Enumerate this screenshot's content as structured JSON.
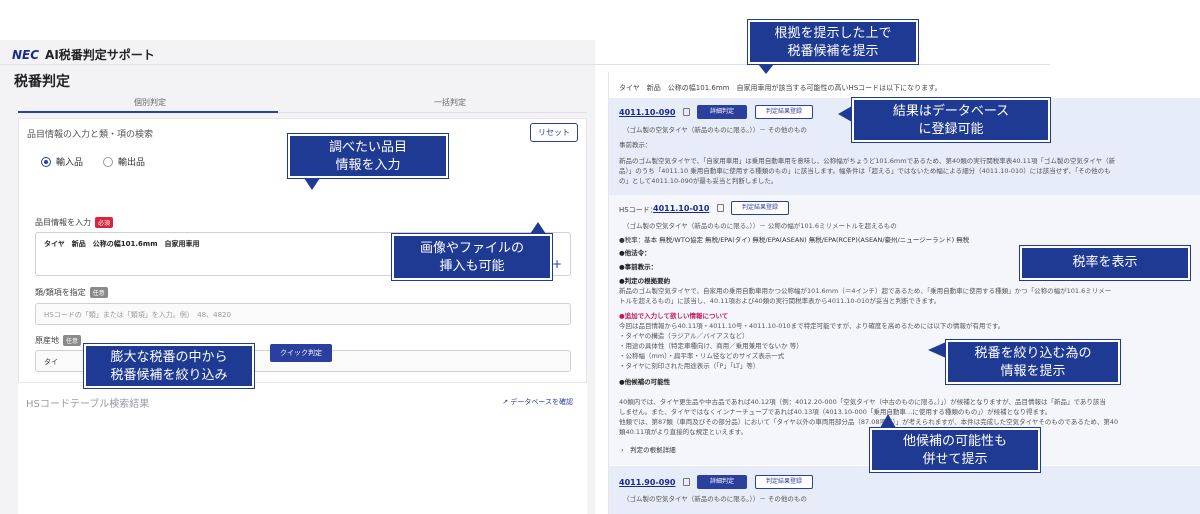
{
  "app": {
    "brand": "NEC",
    "title": "AI税番判定サポート"
  },
  "page_title": "税番判定",
  "tabs": [
    {
      "label": "個別判定"
    },
    {
      "label": "一括判定"
    }
  ],
  "form": {
    "section_title": "品目情報の入力と類・項の検索",
    "reset_label": "リセット",
    "radio_import": "輸入品",
    "radio_export": "輸出品",
    "item_label": "品目情報を入力",
    "required_badge": "必須",
    "item_value": "タイヤ　新品　公称の幅101.6mm　自家用車用",
    "class_label": "類/類項を指定",
    "optional_badge": "任意",
    "class_placeholder": "HSコードの「類」または「類項」を入力。例）　48、4820",
    "origin_label": "原産地",
    "origin_value": "タイ",
    "quick_button": "クイック判定"
  },
  "results_table": {
    "title": "HSコードテーブル検索結果",
    "db_link": "データベースを確認"
  },
  "right": {
    "summary": "タイヤ　新品　公称の幅101.6mm　自家用車用が該当する可能性の高いHSコードは以下になります。",
    "r1": {
      "code": "4011.10-090",
      "detail_btn": "詳細判定",
      "register_btn": "判定結果登録",
      "desc": "（ゴム製の空気タイヤ（新品のものに限る。））－ その他のもの",
      "note_head": "事前教示：",
      "note_l1": "新品のゴム製空気タイヤで、「自家用車用」は乗用自動車用を意味し、公称幅がちょうど101.6mmであるため、第40類の実行関税率表40.11項「ゴム製の空気タイヤ（新",
      "note_l2": "品）」のうち「4011.10 乗用自動車に使用する種類のもの」に該当します。幅条件は「超える」ではないため幅による細分（4011.10-010）には該当せず、「その他のも",
      "note_l3": "の」として4011.10-090が最も妥当と判断しました。"
    },
    "r2": {
      "hs_label": "HSコード：",
      "code": "4011.10-010",
      "register_btn": "判定結果登録",
      "desc": "（ゴム製の空気タイヤ（新品のものに限る。））－ 公称の幅が101.6ミリメートルを超えるもの",
      "tax": "●税率：基本 無税/WTO協定 無税/EPA(タイ) 無税/EPA(ASEAN) 無税/EPA(RCEP)(ASEAN/豪州/ニュージーランド) 無税",
      "other": "●他法令：",
      "prior": "●事前教示：",
      "reason_head": "●判定の根拠要約",
      "reason_l1": "新品のゴム製空気タイヤで、自家用の乗用自動車用かつ公称幅が101.6mm（＝4インチ）超であるため、「乗用自動車に使用する種類」かつ「公称の幅が101.6ミリメー",
      "reason_l2": "トルを超えるもの」に該当し、40.11項および40類の実行関税率表から4011.10-010が妥当と判断できます。",
      "add_head": "●追加で入力して欲しい情報について",
      "add_l1": "今回は品目情報から40.11項・4011.10号・4011.10-010まで特定可能ですが、より確度を高めるためには以下の情報が有用です。",
      "add_l2": "・タイヤの構造（ラジアル／バイアスなど）",
      "add_l3": "・用途の具体性（特定車種向け、商用／乗用兼用でないか 等）",
      "add_l4": "・公称幅（mm）・扁平率・リム径などのサイズ表示一式",
      "add_l5": "・タイヤに刻印された用途表示（「P」「LT」等）",
      "alt_head": "●他候補の可能性",
      "alt_l1": "40類内では、タイヤ更生品や中古品であれば40.12項（例：4012.20-000「空気タイヤ（中古のものに限る。）」）が候補となりますが、品目情報は「新品」であり該当",
      "alt_l2": "しません。また、タイヤではなくインナーチューブであれば40.13項（4013.10-000「乗用自動車…に使用する種類のもの」）が候補となり得ます。",
      "alt_l3": "他類では、第87類（車両及びその部分品）において「タイヤ以外の車両用部分品（87.08項等）」が考えられますが、本件は完成した空気タイヤそのものであるため、第40",
      "alt_l4": "類40.11項がより直接的な規定といえます。",
      "more": "判定の根拠詳細"
    },
    "r3": {
      "code": "4011.90-090",
      "detail_btn": "詳細判定",
      "register_btn": "判定結果登録",
      "desc": "（ゴム製の空気タイヤ（新品のものに限る。））－ その他のもの"
    }
  },
  "callouts": {
    "top_l1": "根拠を提示した上で",
    "top_l2": "税番候補を提示",
    "input_l1": "調べたい品目",
    "input_l2": "情報を入力",
    "image_l1": "画像やファイルの",
    "image_l2": "挿入も可能",
    "narrow_l1": "膨大な税番の中から",
    "narrow_l2": "税番候補を絞り込み",
    "db_l1": "結果はデータベース",
    "db_l2": "に登録可能",
    "tax": "税率を表示",
    "info_l1": "税番を絞り込む為の",
    "info_l2": "情報を提示",
    "alt_l1": "他候補の可能性も",
    "alt_l2": "併せて提示"
  },
  "colors": {
    "primary": "#2a3f9e",
    "callout": "#1f3a93",
    "required": "#d7263d"
  }
}
